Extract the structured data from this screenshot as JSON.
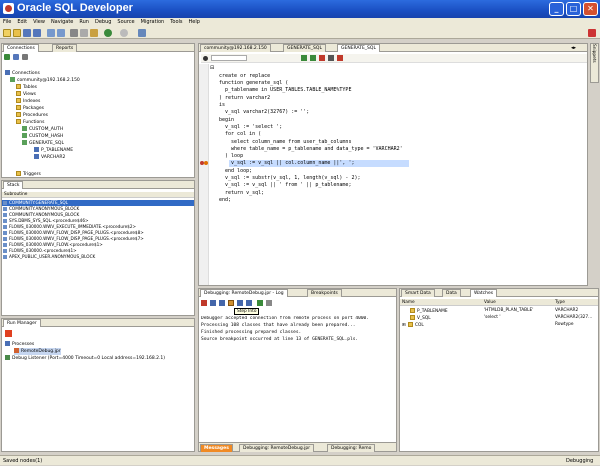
{
  "window": {
    "title": "Oracle SQL Developer",
    "minimize": "_",
    "maximize": "□",
    "close": "✕"
  },
  "menu": [
    "File",
    "Edit",
    "View",
    "Navigate",
    "Run",
    "Debug",
    "Source",
    "Migration",
    "Tools",
    "Help"
  ],
  "connections_panel": {
    "tabs": [
      "Connections",
      "Reports"
    ],
    "tree": [
      "Connections",
      "community@192.168.2.150",
      "Tables",
      "Views",
      "Indexes",
      "Packages",
      "Procedures",
      "Functions",
      "CUSTOM_AUTH",
      "CUSTOM_HASH",
      "GENERATE_SQL",
      "P_TABLENAME",
      "VARCHAR2",
      "Triggers"
    ]
  },
  "stack_panel": {
    "title": "Stack",
    "header": "Subroutine",
    "rows": [
      "COMMUNITY.GENERATE_SQL",
      "COMMUNITY.ANONYMOUS_BLOCK",
      "COMMUNITY.ANONYMOUS_BLOCK",
      "SYS.DBMS_SYS_SQL.<procedure$46>",
      "FLOWS_030000.WWV_EXECUTE_IMMEDIATE.<procedure$2>",
      "FLOWS_030000.WWV_FLOW_DISP_PAGE_PLUGS.<procedure$8>",
      "FLOWS_030000.WWV_FLOW_DISP_PAGE_PLUGS.<procedure$7>",
      "FLOWS_030000.WWV_FLOW.<procedure$1>",
      "FLOWS_030000.<procedure$1>",
      "APEX_PUBLIC_USER.ANONYMOUS_BLOCK"
    ]
  },
  "run_manager": {
    "title": "Run Manager",
    "processes": "Processes",
    "job": "RemoteDebug.jpr",
    "listener": "Debug Listener (Port=4000 Timeout=0 Local address=192.168.2.1)"
  },
  "editor": {
    "tabs": [
      "community@192.168.2.150",
      "GENERATE_SQL",
      "GENERATE_SQL"
    ],
    "lines": [
      "create or replace",
      "function generate_sql (",
      "  p_tablename in USER_TABLES.TABLE_NAME%TYPE",
      ") return varchar2",
      "is",
      "  v_sql varchar2(32767) := '';",
      "begin",
      "  v_sql := 'select ';",
      "  for col in (",
      "    select column_name from user_tab_columns",
      "    where table_name = p_tablename and data_type = 'VARCHAR2'",
      "  ) loop",
      "    v_sql := v_sql || col.column_name ||', ';",
      "  end loop;",
      "  v_sql := substr(v_sql, 1, length(v_sql) - 2);",
      "  v_sql := v_sql || ' from ' || p_tablename;",
      "  return v_sql;",
      "end;"
    ]
  },
  "log_panel": {
    "tabs": [
      "Debugging: RemoteDebug.jpr - Log",
      "Breakpoints"
    ],
    "tooltip": "Step Into",
    "lines": [
      "Debugger accepted connection from remote process on port 4000.",
      "Processing 108 classes that have already been prepared...",
      "Finished processing prepared classes.",
      "Source breakpoint occurred at line 13 of GENERATE_SQL.pls."
    ],
    "bottom_tabs": [
      "Messages",
      "Debugging: RemoteDebug.jpr",
      "Debugging: Remo"
    ]
  },
  "data_panel": {
    "tabs": [
      "Smart Data",
      "Data",
      "Watches"
    ],
    "columns": [
      "Name",
      "Value",
      "Type"
    ],
    "rows": [
      {
        "name": "P_TABLENAME",
        "value": "'HTMLDB_PLAN_TABLE'",
        "type": "VARCHAR2"
      },
      {
        "name": "V_SQL",
        "value": "'select '",
        "type": "VARCHAR2(327..."
      },
      {
        "name": "COL",
        "value": "",
        "type": "Rowtype"
      }
    ]
  },
  "side_tab": "Snippets",
  "status": {
    "left": "Saved nodes(1)",
    "right": "Debugging"
  }
}
